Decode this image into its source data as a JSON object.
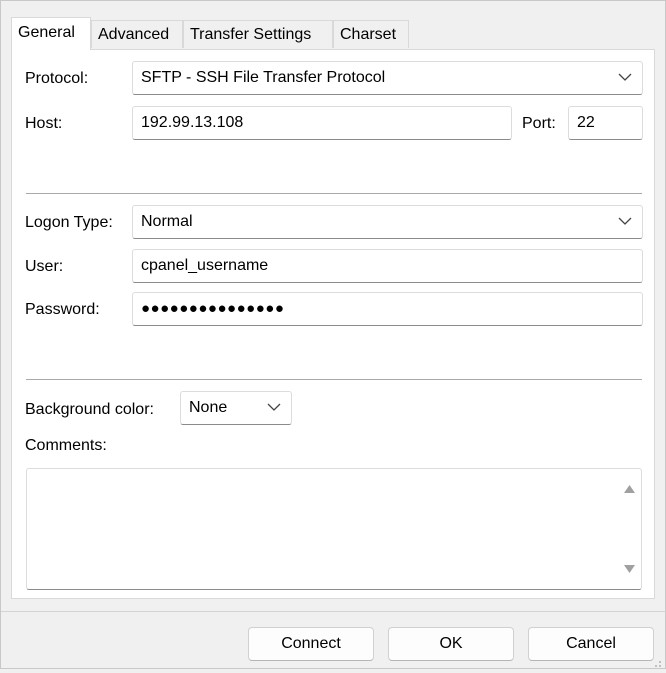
{
  "tabs": [
    {
      "label": "General",
      "active": true
    },
    {
      "label": "Advanced",
      "active": false
    },
    {
      "label": "Transfer Settings",
      "active": false
    },
    {
      "label": "Charset",
      "active": false
    }
  ],
  "connection": {
    "protocol_label": "Protocol:",
    "protocol_value": "SFTP - SSH File Transfer Protocol",
    "host_label": "Host:",
    "host_value": "192.99.13.108",
    "port_label": "Port:",
    "port_value": "22"
  },
  "logon": {
    "logon_type_label": "Logon Type:",
    "logon_type_value": "Normal",
    "user_label": "User:",
    "user_value": "cpanel_username",
    "password_label": "Password:",
    "password_value": "●●●●●●●●●●●●●●●"
  },
  "misc": {
    "background_color_label": "Background color:",
    "background_color_value": "None",
    "comments_label": "Comments:",
    "comments_value": ""
  },
  "buttons": {
    "connect": "Connect",
    "ok": "OK",
    "cancel": "Cancel"
  },
  "icons": [
    "chevron-down-icon",
    "scroll-up-arrow-icon",
    "scroll-down-arrow-icon",
    "resize-grip-icon"
  ]
}
